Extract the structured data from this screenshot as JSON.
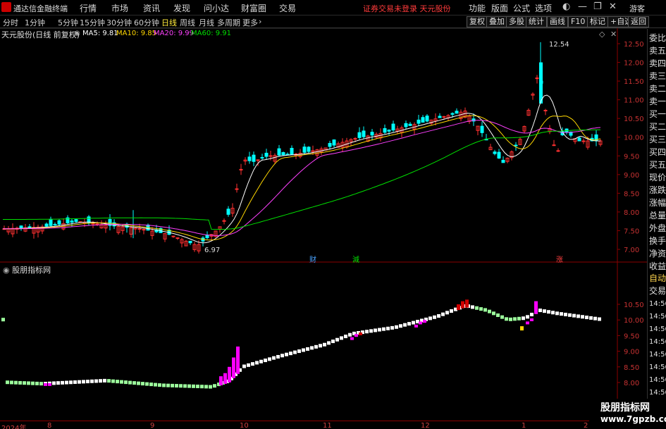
{
  "menubar": {
    "app_title": "通达信金融终端",
    "items": [
      "行情",
      "市场",
      "资讯",
      "发现",
      "问小达",
      "财富圈",
      "交易"
    ],
    "notice": "证券交易未登录  天元股份",
    "right_items": [
      "功能",
      "版面",
      "公式",
      "选项"
    ],
    "guest": "游客"
  },
  "toolbar": {
    "periods": [
      "分时",
      "1分钟",
      "5分钟",
      "15分钟",
      "30分钟",
      "60分钟",
      "日线",
      "周线",
      "月线",
      "多周期",
      "更多"
    ],
    "active": "日线",
    "buttons": [
      "复权",
      "叠加",
      "多股",
      "统计",
      "画线",
      "F10",
      "标记",
      "+自选",
      "返回"
    ]
  },
  "stock": {
    "name": "天元股份(日线 前复权)",
    "ma5": "MA5: 9.81",
    "ma10": "MA10: 9.85",
    "ma20": "MA20: 9.99",
    "ma60": "MA60: 9.91",
    "ma5_color": "#ffffff",
    "ma10_color": "#ffd700",
    "ma20_color": "#ff40ff",
    "ma60_color": "#00e000",
    "high_label": "12.54",
    "low_label": "6.97"
  },
  "price_axis": [
    "12.50",
    "12.00",
    "11.50",
    "11.00",
    "10.50",
    "10.00",
    "9.50",
    "9.00",
    "8.50",
    "8.00",
    "7.50",
    "7.00"
  ],
  "lower": {
    "title": "股朋指标网",
    "axis": [
      "10.50",
      "10.00",
      "9.50",
      "9.00",
      "8.50",
      "8.00"
    ]
  },
  "right_panel": {
    "items": [
      "委比",
      "卖五",
      "卖四",
      "卖三",
      "卖二",
      "卖一",
      "买一",
      "买二",
      "买三",
      "买四",
      "买五",
      "现价",
      "涨跌",
      "涨幅",
      "总量",
      "外盘",
      "换手",
      "净资",
      "收益"
    ],
    "auto_label": "自动",
    "trade_label": "交易",
    "times": [
      "14:56",
      "14:56",
      "14:56",
      "14:56",
      "14:56",
      "14:56",
      "14:56",
      "14:56",
      "14:56",
      "14:56"
    ]
  },
  "annotations": {
    "cai": "财",
    "jian": "減",
    "zhang": "涨"
  },
  "dates": [
    {
      "label": "2024年"
    },
    {
      "label": "8"
    },
    {
      "label": "9"
    },
    {
      "label": "10"
    },
    {
      "label": "11"
    },
    {
      "label": "12"
    },
    {
      "label": "1"
    },
    {
      "label": "2"
    }
  ],
  "watermark": {
    "line1": "股朋指标网",
    "line2": "www.7gpzb.com"
  },
  "colors": {
    "up": "#ff3030",
    "down": "#00ffff",
    "magenta": "#ff00ff",
    "green": "#00e000",
    "yellow": "#ffd700"
  }
}
